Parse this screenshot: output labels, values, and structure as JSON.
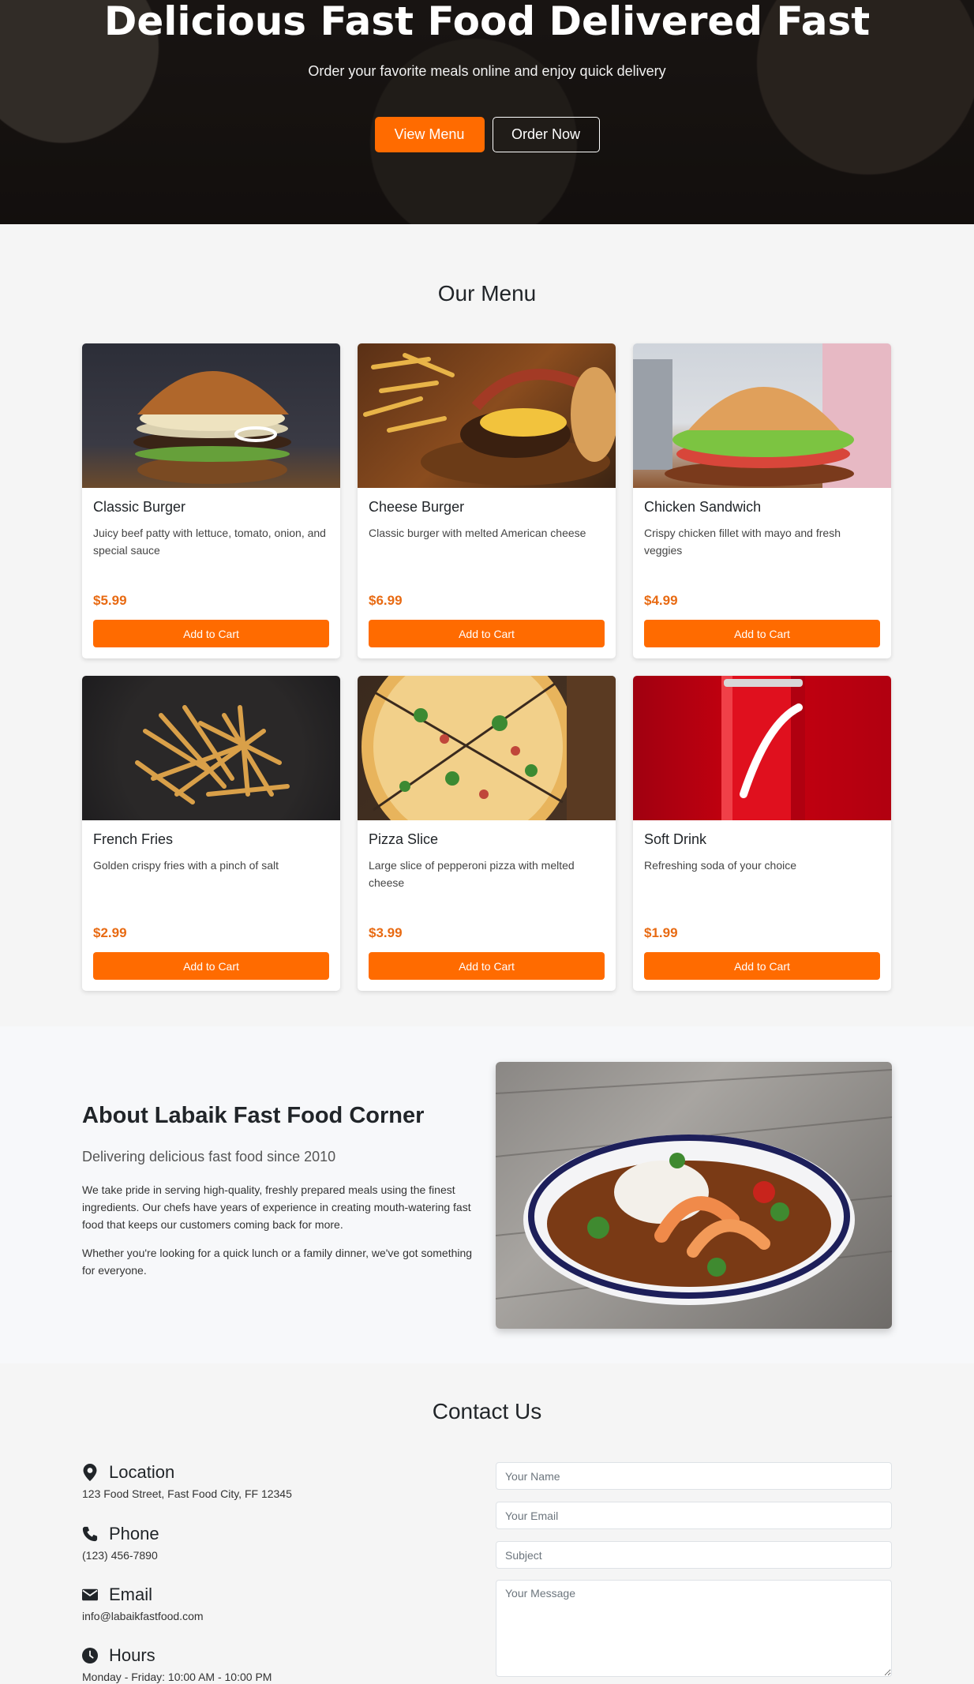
{
  "hero": {
    "title": "Delicious Fast Food Delivered Fast",
    "subtitle": "Order your favorite meals online and enjoy quick delivery",
    "primary_btn": "View Menu",
    "secondary_btn": "Order Now"
  },
  "menu": {
    "title": "Our Menu",
    "items": [
      {
        "name": "Classic Burger",
        "desc": "Juicy beef patty with lettuce, tomato, onion, and special sauce",
        "price": "$5.99",
        "btn": "Add to Cart",
        "image": "burger"
      },
      {
        "name": "Cheese Burger",
        "desc": "Classic burger with melted American cheese",
        "price": "$6.99",
        "btn": "Add to Cart",
        "image": "cheese-burger"
      },
      {
        "name": "Chicken Sandwich",
        "desc": "Crispy chicken fillet with mayo and fresh veggies",
        "price": "$4.99",
        "btn": "Add to Cart",
        "image": "chicken-sandwich"
      },
      {
        "name": "French Fries",
        "desc": "Golden crispy fries with a pinch of salt",
        "price": "$2.99",
        "btn": "Add to Cart",
        "image": "fries"
      },
      {
        "name": "Pizza Slice",
        "desc": "Large slice of pepperoni pizza with melted cheese",
        "price": "$3.99",
        "btn": "Add to Cart",
        "image": "pizza"
      },
      {
        "name": "Soft Drink",
        "desc": "Refreshing soda of your choice",
        "price": "$1.99",
        "btn": "Add to Cart",
        "image": "soda"
      }
    ]
  },
  "about": {
    "title": "About Labaik Fast Food Corner",
    "lead": "Delivering delicious fast food since 2010",
    "p1": "We take pride in serving high-quality, freshly prepared meals using the finest ingredients. Our chefs have years of experience in creating mouth-watering fast food that keeps our customers coming back for more.",
    "p2": "Whether you're looking for a quick lunch or a family dinner, we've got something for everyone."
  },
  "contact": {
    "title": "Contact Us",
    "location_label": "Location",
    "location_value": "123 Food Street, Fast Food City, FF 12345",
    "phone_label": "Phone",
    "phone_value": "(123) 456-7890",
    "email_label": "Email",
    "email_value": "info@labaikfastfood.com",
    "hours_label": "Hours",
    "hours_value": "Monday - Friday: 10:00 AM - 10:00 PM",
    "form": {
      "name_placeholder": "Your Name",
      "email_placeholder": "Your Email",
      "subject_placeholder": "Subject",
      "message_placeholder": "Your Message"
    }
  },
  "colors": {
    "accent": "#ff6b00",
    "price": "#e86a12",
    "page_bg": "#f5f5f5"
  },
  "icons": [
    "map-marker-icon",
    "phone-icon",
    "envelope-icon",
    "clock-icon"
  ]
}
